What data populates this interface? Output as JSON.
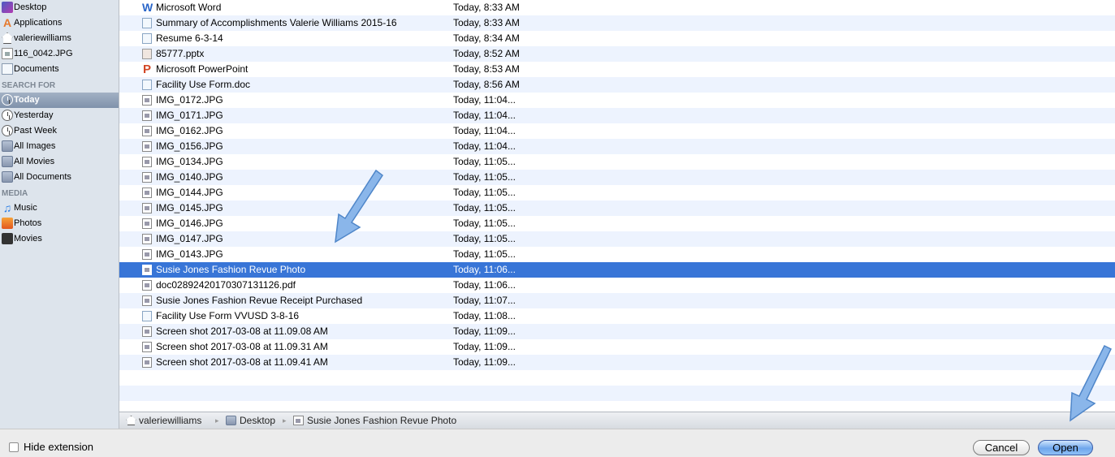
{
  "sidebar": {
    "devices": [
      {
        "label": "Desktop",
        "icon": "desktop-icon"
      },
      {
        "label": "Applications",
        "icon": "applications-icon"
      },
      {
        "label": "valeriewilliams",
        "icon": "home-icon"
      },
      {
        "label": "116_0042.JPG",
        "icon": "image-file-icon"
      },
      {
        "label": "Documents",
        "icon": "documents-icon"
      }
    ],
    "search_header": "SEARCH FOR",
    "search": [
      {
        "label": "Today",
        "icon": "clock-icon"
      },
      {
        "label": "Yesterday",
        "icon": "clock-icon"
      },
      {
        "label": "Past Week",
        "icon": "clock-icon"
      },
      {
        "label": "All Images",
        "icon": "smart-folder-icon"
      },
      {
        "label": "All Movies",
        "icon": "smart-folder-icon"
      },
      {
        "label": "All Documents",
        "icon": "smart-folder-icon"
      }
    ],
    "media_header": "MEDIA",
    "media": [
      {
        "label": "Music",
        "icon": "music-icon"
      },
      {
        "label": "Photos",
        "icon": "photos-icon"
      },
      {
        "label": "Movies",
        "icon": "movies-icon"
      }
    ]
  },
  "files": [
    {
      "name": "Microsoft Word",
      "date": "Today, 8:33 AM",
      "icon": "word-icon"
    },
    {
      "name": "Summary of Accomplishments Valerie Williams 2015-16",
      "date": "Today, 8:33 AM",
      "icon": "document-icon"
    },
    {
      "name": "Resume 6-3-14",
      "date": "Today, 8:34 AM",
      "icon": "document-icon"
    },
    {
      "name": "85777.pptx",
      "date": "Today, 8:52 AM",
      "icon": "pptx-file-icon"
    },
    {
      "name": "Microsoft PowerPoint",
      "date": "Today, 8:53 AM",
      "icon": "powerpoint-icon"
    },
    {
      "name": "Facility Use Form.doc",
      "date": "Today, 8:56 AM",
      "icon": "document-icon"
    },
    {
      "name": "IMG_0172.JPG",
      "date": "Today, 11:04...",
      "icon": "image-file-icon"
    },
    {
      "name": "IMG_0171.JPG",
      "date": "Today, 11:04...",
      "icon": "image-file-icon"
    },
    {
      "name": "IMG_0162.JPG",
      "date": "Today, 11:04...",
      "icon": "image-file-icon"
    },
    {
      "name": "IMG_0156.JPG",
      "date": "Today, 11:04...",
      "icon": "image-file-icon"
    },
    {
      "name": "IMG_0134.JPG",
      "date": "Today, 11:05...",
      "icon": "image-file-icon"
    },
    {
      "name": "IMG_0140.JPG",
      "date": "Today, 11:05...",
      "icon": "image-file-icon"
    },
    {
      "name": "IMG_0144.JPG",
      "date": "Today, 11:05...",
      "icon": "image-file-icon"
    },
    {
      "name": "IMG_0145.JPG",
      "date": "Today, 11:05...",
      "icon": "image-file-icon"
    },
    {
      "name": "IMG_0146.JPG",
      "date": "Today, 11:05...",
      "icon": "image-file-icon"
    },
    {
      "name": "IMG_0147.JPG",
      "date": "Today, 11:05...",
      "icon": "image-file-icon"
    },
    {
      "name": "IMG_0143.JPG",
      "date": "Today, 11:05...",
      "icon": "image-file-icon"
    },
    {
      "name": "Susie Jones Fashion Revue Photo",
      "date": "Today, 11:06...",
      "icon": "image-file-icon",
      "selected": true
    },
    {
      "name": "doc02892420170307131126.pdf",
      "date": "Today, 11:06...",
      "icon": "image-file-icon"
    },
    {
      "name": "Susie Jones Fashion Revue Receipt Purchased",
      "date": "Today, 11:07...",
      "icon": "image-file-icon"
    },
    {
      "name": "Facility Use Form VVUSD 3-8-16",
      "date": "Today, 11:08...",
      "icon": "document-icon"
    },
    {
      "name": "Screen shot 2017-03-08 at 11.09.08 AM",
      "date": "Today, 11:09...",
      "icon": "image-file-icon"
    },
    {
      "name": "Screen shot 2017-03-08 at 11.09.31 AM",
      "date": "Today, 11:09...",
      "icon": "image-file-icon"
    },
    {
      "name": "Screen shot 2017-03-08 at 11.09.41 AM",
      "date": "Today, 11:09...",
      "icon": "image-file-icon"
    }
  ],
  "pathbar": {
    "segments": [
      {
        "label": "valeriewilliams",
        "icon": "home-icon"
      },
      {
        "label": "Desktop",
        "icon": "folder-icon"
      },
      {
        "label": "Susie Jones Fashion Revue Photo",
        "icon": "image-file-icon"
      }
    ]
  },
  "bottom": {
    "hide_extension_label": "Hide extension",
    "hide_extension_checked": false,
    "cancel_label": "Cancel",
    "open_label": "Open"
  },
  "colors": {
    "selection": "#3875d7",
    "sidebar_bg": "#dde4ec",
    "row_stripe": "#edf3fe",
    "annotation_arrow": "#7aaee6"
  }
}
